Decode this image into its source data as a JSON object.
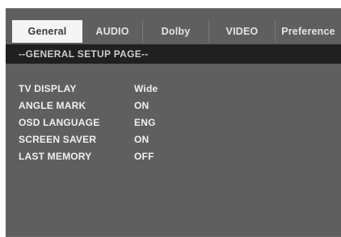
{
  "tabs": [
    {
      "label": "General",
      "active": true
    },
    {
      "label": "AUDIO",
      "active": false
    },
    {
      "label": "Dolby",
      "active": false
    },
    {
      "label": "VIDEO",
      "active": false
    },
    {
      "label": "Preference",
      "active": false
    }
  ],
  "header": {
    "title": "--GENERAL SETUP PAGE--"
  },
  "settings": [
    {
      "label": "TV DISPLAY",
      "value": "Wide"
    },
    {
      "label": "ANGLE MARK",
      "value": "ON"
    },
    {
      "label": "OSD LANGUAGE",
      "value": "ENG"
    },
    {
      "label": "SCREEN SAVER",
      "value": "ON"
    },
    {
      "label": "LAST MEMORY",
      "value": "OFF"
    }
  ],
  "colors": {
    "panel": "#5f5f5f",
    "header_bar": "#202020",
    "active_tab": "#f5f5f5",
    "text": "#f0f0f0"
  }
}
